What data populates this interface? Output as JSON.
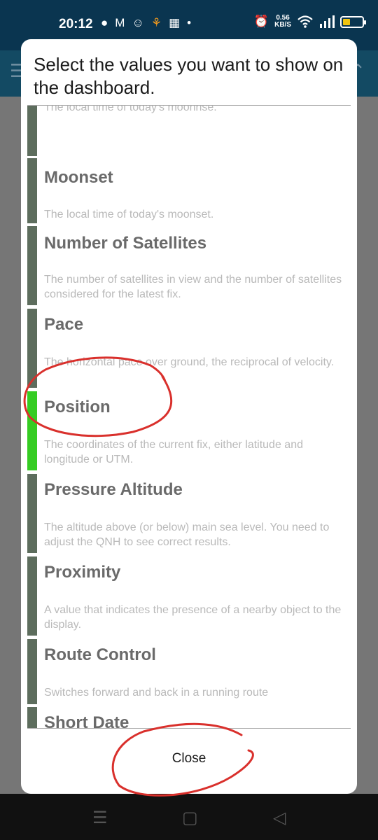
{
  "status_bar": {
    "time": "20:12",
    "net_speed_value": "0.56",
    "net_speed_unit": "KB/S",
    "left_icons": [
      "chat-bubble-icon",
      "mail-icon",
      "smile-app-icon",
      "cat-app-icon",
      "grid-app-icon",
      "dot-icon"
    ],
    "right_icons": [
      "alarm-icon",
      "wifi-icon",
      "signal-icon",
      "battery-icon"
    ],
    "battery_level": 0.4,
    "battery_color": "#f1c40f"
  },
  "dialog": {
    "title": "Select the values you want to show on the dashboard.",
    "close_label": "Close",
    "items": [
      {
        "title": "",
        "desc": "The local time of today's moonrise.",
        "selected": false
      },
      {
        "title": "Moonset",
        "desc": "The local time of today's moonset.",
        "selected": false
      },
      {
        "title": "Number of Satellites",
        "desc": "The number of satellites in view and the number of satellites considered for the latest fix.",
        "selected": false
      },
      {
        "title": "Pace",
        "desc": "The horizontal pace over ground, the reciprocal of velocity.",
        "selected": false
      },
      {
        "title": "Position",
        "desc": "The coordinates of the current fix, either latitude and longitude or UTM.",
        "selected": true
      },
      {
        "title": "Pressure Altitude",
        "desc": "The altitude above (or below) main sea level. You need to adjust the QNH to see correct results.",
        "selected": false
      },
      {
        "title": "Proximity",
        "desc": "A value that indicates the presence of a nearby object to the display.",
        "selected": false
      },
      {
        "title": "Route Control",
        "desc": "Switches forward and back in a running route",
        "selected": false
      },
      {
        "title": "Short Date",
        "desc": "",
        "selected": false
      }
    ]
  },
  "colors": {
    "selected_bar": "#35cc23",
    "unselected_bar": "#5d6d5d",
    "annotation": "#d9302c"
  }
}
